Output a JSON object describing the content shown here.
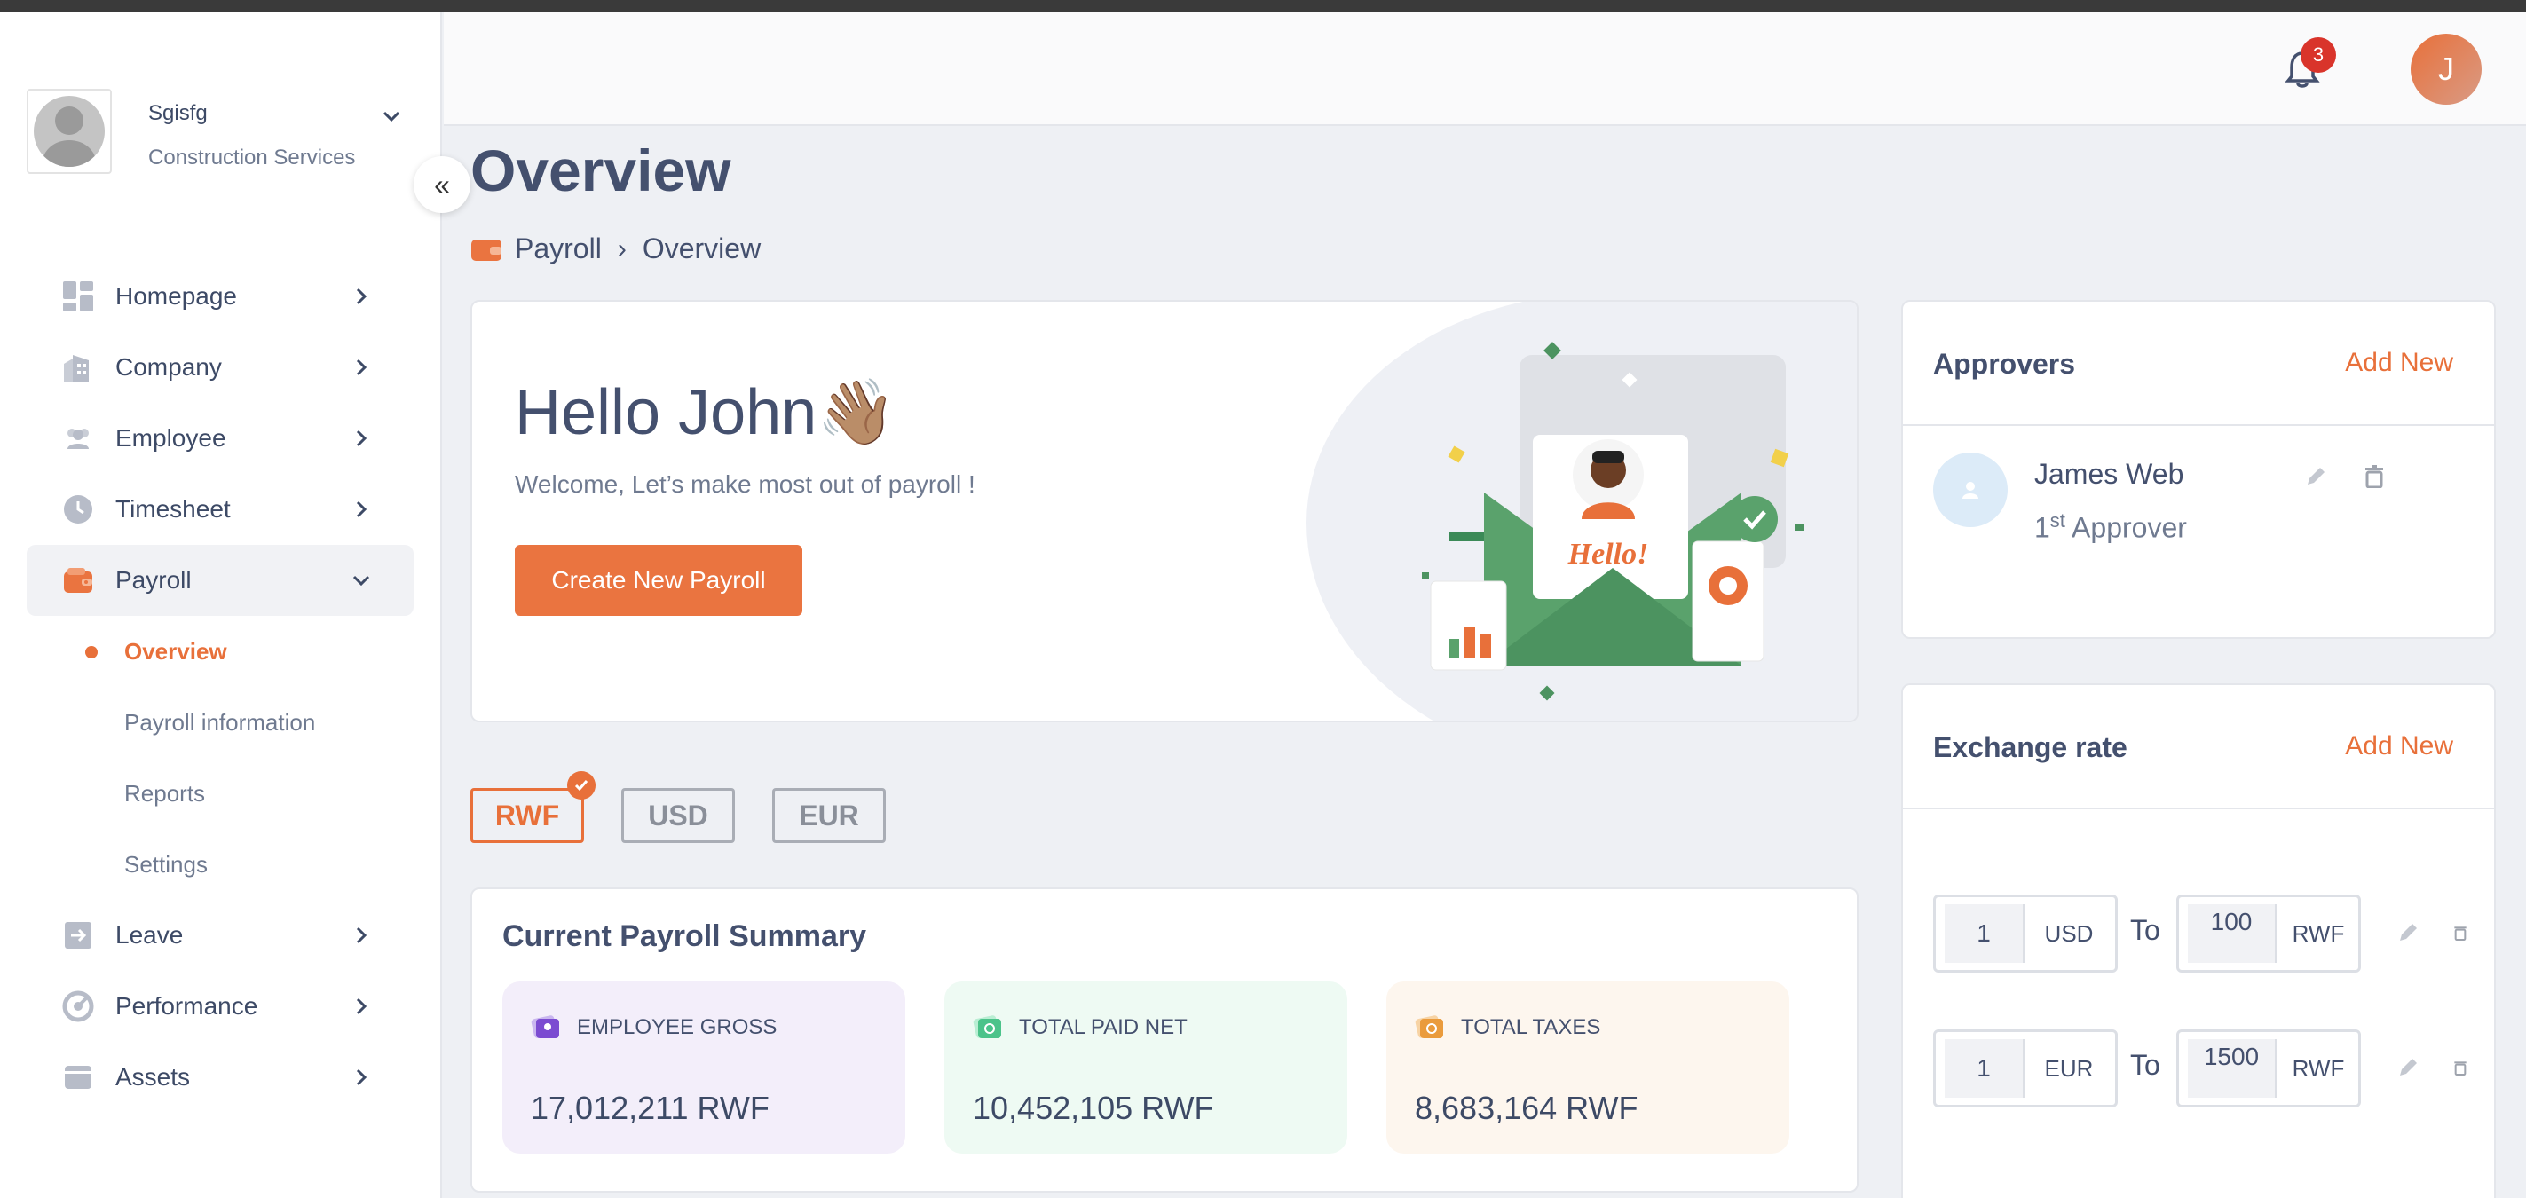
{
  "org": {
    "name": "Sgisfg",
    "subtitle": "Construction Services"
  },
  "nav": {
    "items": [
      {
        "label": "Homepage"
      },
      {
        "label": "Company"
      },
      {
        "label": "Employee"
      },
      {
        "label": "Timesheet"
      },
      {
        "label": "Payroll"
      },
      {
        "label": "Leave"
      },
      {
        "label": "Performance"
      },
      {
        "label": "Assets"
      }
    ],
    "payroll_sub": [
      {
        "label": "Overview"
      },
      {
        "label": "Payroll information"
      },
      {
        "label": "Reports"
      },
      {
        "label": "Settings"
      }
    ]
  },
  "header": {
    "notification_count": "3",
    "user_initial": "J"
  },
  "page": {
    "title": "Overview",
    "breadcrumb": [
      "Payroll",
      "Overview"
    ]
  },
  "hero": {
    "title": "Hello John👋🏽",
    "subtitle": "Welcome, Let’s make most out of payroll !",
    "button": "Create New Payroll",
    "illustration_text": "Hello!"
  },
  "currencies": [
    "RWF",
    "USD",
    "EUR"
  ],
  "summary": {
    "title": "Current Payroll Summary",
    "stats": [
      {
        "label": "EMPLOYEE GROSS",
        "value": "17,012,211 RWF",
        "bg": "#f3eefa",
        "icon_color": "#7b4bd1"
      },
      {
        "label": "TOTAL PAID NET",
        "value": "10,452,105 RWF",
        "bg": "#eefaf3",
        "icon_color": "#4cc38a"
      },
      {
        "label": "TOTAL TAXES",
        "value": "8,683,164 RWF",
        "bg": "#fdf6ee",
        "icon_color": "#ea9b3c"
      }
    ]
  },
  "approvers": {
    "title": "Approvers",
    "add_label": "Add New",
    "items": [
      {
        "name": "James Web",
        "role_num": "1",
        "role_sup": "st",
        "role_text": " Approver"
      }
    ]
  },
  "exchange": {
    "title": "Exchange rate",
    "add_label": "Add New",
    "to_label": "To",
    "rows": [
      {
        "from_amount": "1",
        "from_currency": "USD",
        "to_amount": "100",
        "to_currency": "RWF"
      },
      {
        "from_amount": "1",
        "from_currency": "EUR",
        "to_amount": "1500",
        "to_currency": "RWF"
      }
    ]
  },
  "colors": {
    "accent": "#e8703a",
    "badge": "#d9342b",
    "text": "#44506e"
  },
  "icons": {
    "nav": [
      "dashboard-icon",
      "building-icon",
      "users-icon",
      "clock-icon",
      "wallet-icon",
      "leave-icon",
      "gauge-icon",
      "assets-icon"
    ]
  }
}
